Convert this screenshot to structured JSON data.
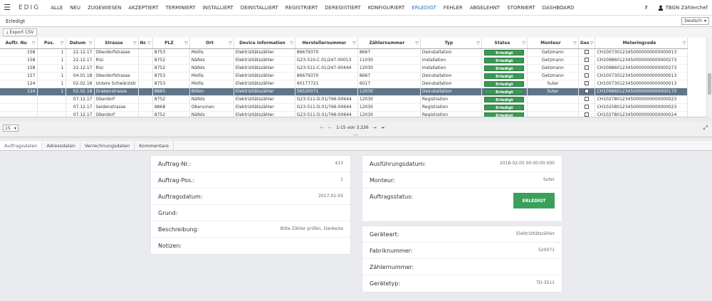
{
  "nav": {
    "menu_icon": "hamburger-icon",
    "logo": "EDIG",
    "items": [
      "ALLE",
      "NEU",
      "ZUGEWIESEN",
      "AKZEPTIERT",
      "TERMINIERT",
      "INSTALLIERT",
      "DEINSTALLIERT",
      "REGISTRIERT",
      "DEREGISTIERT",
      "KONFIGURIERT",
      "ERLEDIGT",
      "FEHLER",
      "ABGELEHNT",
      "STORNIERT",
      "DASHBOARD"
    ],
    "active": "ERLEDIGT",
    "help": "?",
    "user": "TBGN Zählerchef",
    "user_icon": "user-icon"
  },
  "section": {
    "title": "Erledigt",
    "language": "Deutsch"
  },
  "toolbar": {
    "export_label": "Export CSV",
    "export_icon": "download-icon"
  },
  "grid": {
    "columns": [
      "Auftr. Nu",
      "Pos.",
      "Datum",
      "Strasse",
      "Nr.",
      "PLZ",
      "Ort",
      "Device Information",
      "Herstellernummer",
      "Zählernummer",
      "Typ",
      "Status",
      "Monteur",
      "Ges",
      "Meteringcode"
    ],
    "rows": [
      [
        "158",
        "1",
        "22.12.17",
        "Oberdorfstrasse",
        "",
        "8753",
        "Mollis",
        "Elektrizitätszähler",
        "86679370",
        "8667",
        "Deinstallation",
        "Erledigt",
        "Getzmann",
        "",
        "CH100730123450000000000000013"
      ],
      [
        "158",
        "1",
        "22.12.17",
        "Risi",
        "",
        "8752",
        "Näfels",
        "Elektrizitätszähler",
        "G23-510-C.01/247-00013",
        "11030",
        "Installation",
        "Erledigt",
        "Getzmann",
        "",
        "CH109860123450000000000000273"
      ],
      [
        "158",
        "1",
        "22.12.17",
        "Risi",
        "",
        "8752",
        "Näfels",
        "Elektrizitätszähler",
        "G23-511-C.01/247-00444",
        "12030",
        "Installation",
        "Erledigt",
        "Getzmann",
        "",
        "CH109860123450000000000000273"
      ],
      [
        "157",
        "1",
        "04.01.18",
        "Oberdorfstrasse",
        "",
        "8753",
        "Mollis",
        "Elektrizitätszähler",
        "86679370",
        "8667",
        "Deinstallation",
        "Erledigt",
        "Getzmann",
        "",
        "CH100730123450000000000000013"
      ],
      [
        "124",
        "1",
        "02.02.18",
        "Untere Schwärzistr",
        "",
        "8753",
        "Mollis",
        "Elektrizitätszähler",
        "60177721",
        "6017",
        "Deinstallation",
        "Erledigt",
        "Suter",
        "",
        "CH100730123450000000000000013"
      ],
      [
        "124",
        "1",
        "02.02.18",
        "Grabenstrasse",
        "",
        "8865",
        "Bilten",
        "Elektrizitätszähler",
        "56520071",
        "12030",
        "Deinstallation",
        "Erledigt",
        "Suter",
        "",
        "CH109860123450000000000000170"
      ],
      [
        "",
        "",
        "07.12.17",
        "Oberdorf",
        "",
        "8752",
        "Näfels",
        "Elektrizitätszähler",
        "G23-511-D.01/766-00644",
        "12030",
        "Registration",
        "Erledigt",
        "",
        "",
        "CH102780123450000000000000023"
      ],
      [
        "",
        "",
        "07.12.17",
        "Seidenstrasse",
        "",
        "8868",
        "Oberurnen",
        "Elektrizitätszähler",
        "G23-511-D.01/766-00644",
        "12030",
        "Registration",
        "Erledigt",
        "",
        "",
        "CH102580123450000000000000023"
      ],
      [
        "",
        "",
        "07.12.17",
        "Oberdorf",
        "",
        "8752",
        "Näfels",
        "Elektrizitätszähler",
        "G23-511-D.01/766-00644",
        "12030",
        "Registration",
        "Erledigt",
        "",
        "",
        "CH102780123450000000000000024"
      ]
    ],
    "selected_row": 5
  },
  "pager": {
    "page_size": "15",
    "range": "1-15 von 3.226",
    "more": "...",
    "first_icon": "first-page-icon",
    "prev_icon": "prev-page-icon",
    "next_icon": "next-page-icon",
    "last_icon": "last-page-icon",
    "resize_icon": "resize-icon"
  },
  "tabs": [
    "Auftragsdaten",
    "Adressdaten",
    "Verrechnungsdaten",
    "Kommentare"
  ],
  "details": {
    "left": [
      {
        "label": "Auftrag-Nr.:",
        "value": "413"
      },
      {
        "label": "Auftrag-Pos.:",
        "value": "1"
      },
      {
        "label": "Auftragsdatum:",
        "value": "2017-01-03"
      },
      {
        "label": "Grund:",
        "value": ""
      },
      {
        "label": "Beschreibung:",
        "value": "Bitte Zähler prüfen, Danke/ss"
      },
      {
        "label": "Notizen:",
        "value": ""
      }
    ],
    "right_top": [
      {
        "label": "Ausführungsdatum:",
        "value": "2018-02-05 00:00:00.000"
      },
      {
        "label": "Monteur:",
        "value": "Suter"
      },
      {
        "label": "Auftragsstatus:",
        "value": "ERLEDIGT"
      }
    ],
    "right_bottom": [
      {
        "label": "Geräteart:",
        "value": "Elektrizitätszähler"
      },
      {
        "label": "Fabriknummer:",
        "value": "520071"
      },
      {
        "label": "Zählernummer:",
        "value": ""
      },
      {
        "label": "Gerätetyp:",
        "value": "TD-3511"
      }
    ]
  },
  "colors": {
    "accent": "#2f6fb3",
    "status_green": "#3a9a53",
    "selected_row": "#60758a"
  }
}
